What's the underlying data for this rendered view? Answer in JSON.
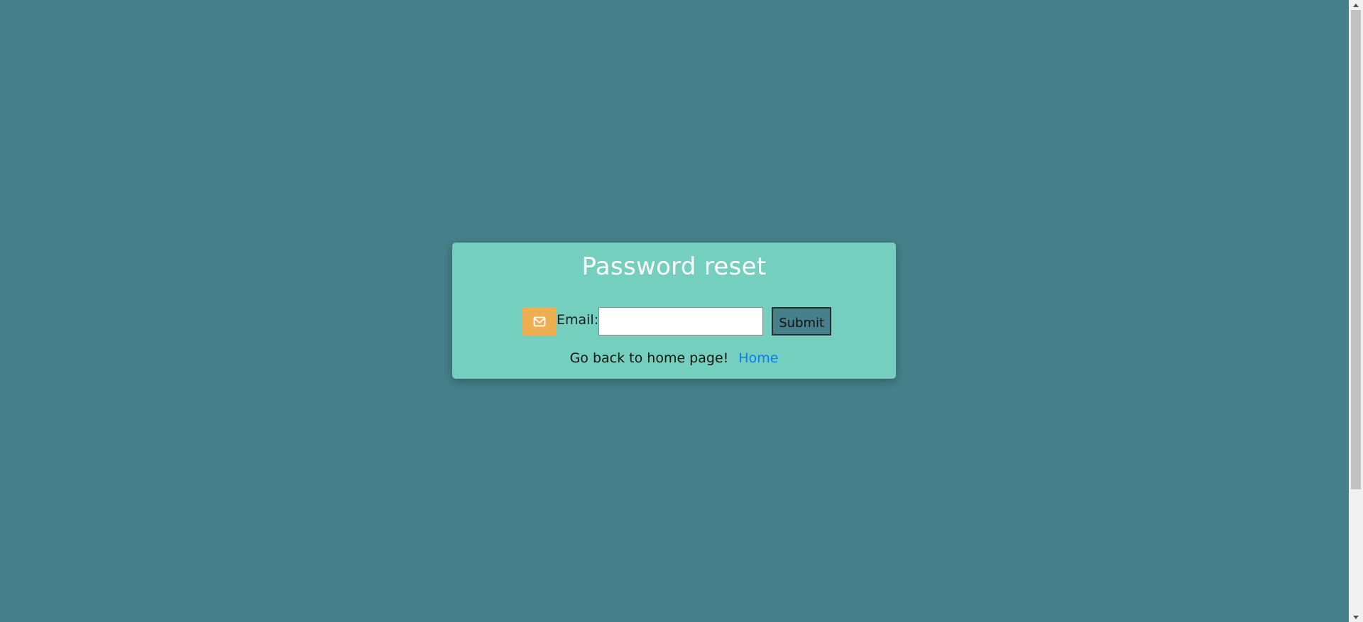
{
  "page": {
    "background_color": "#45808b"
  },
  "card": {
    "title": "Password reset",
    "background_color": "#74cfbf"
  },
  "form": {
    "icon": "envelope-icon",
    "icon_bg_color": "#eeae52",
    "email_label": "Email:",
    "email_value": "",
    "email_placeholder": "",
    "submit_label": "Submit"
  },
  "footer": {
    "text": "Go back to home page!",
    "link_label": "Home",
    "link_color": "#0a7bf0"
  }
}
